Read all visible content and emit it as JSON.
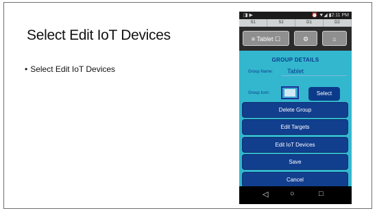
{
  "slide": {
    "title": "Select Edit IoT Devices",
    "bullet": "Select Edit IoT Devices",
    "bullet_marker": "•"
  },
  "phone": {
    "status_left_icons": "◨ ▶",
    "status_right": "⏰ ▼◢ ▮2:11 PM",
    "tabs": [
      "S1",
      "S2",
      "D1",
      "D2"
    ],
    "topbar": {
      "device_button": "≡ Tablet ☐",
      "settings_icon": "⚙",
      "home_icon": "⌂"
    },
    "group_details": {
      "title": "GROUP DETAILS",
      "name_label": "Group Name:",
      "name_value": "Tablet",
      "icon_label": "Group Icon:",
      "select_label": "Select"
    },
    "actions": {
      "delete_group": "Delete Group",
      "edit_targets": "Edit Targets",
      "edit_iot_devices": "Edit IoT Devices",
      "save": "Save",
      "cancel": "Cancel"
    },
    "nav": {
      "back": "◁",
      "home": "○",
      "recent": "□"
    }
  }
}
